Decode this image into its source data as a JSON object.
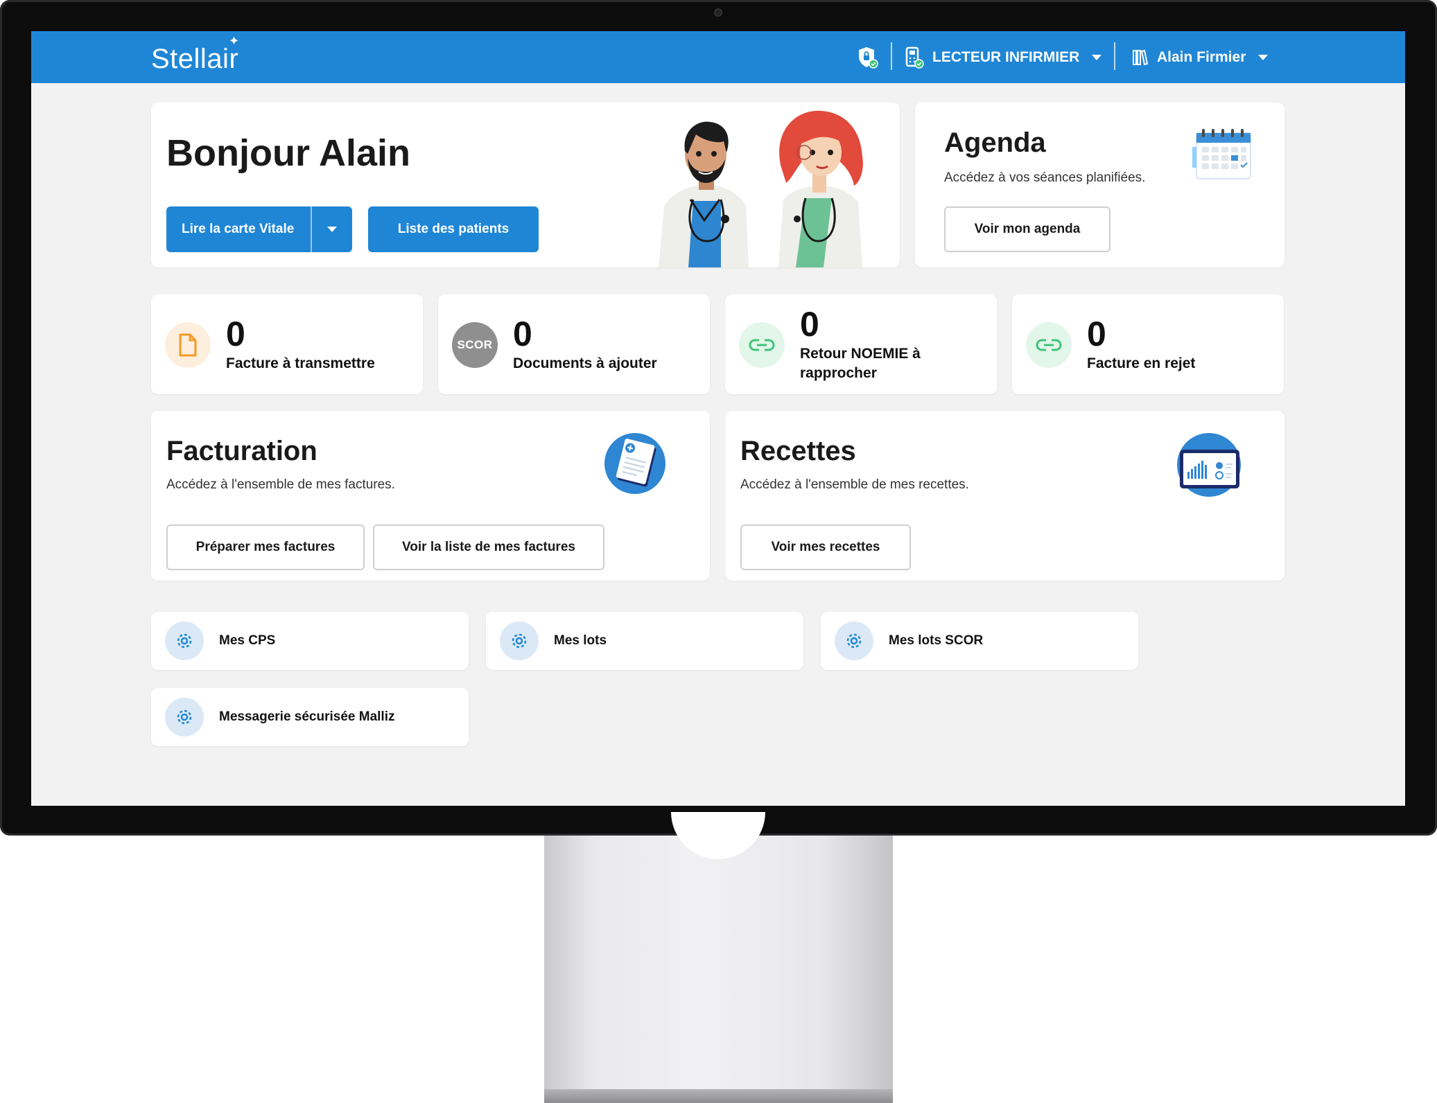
{
  "header": {
    "logo": "Stellair",
    "reader_label": "LECTEUR INFIRMIER",
    "user_name": "Alain Firmier"
  },
  "welcome": {
    "title": "Bonjour Alain",
    "vitale_button": "Lire la carte Vitale",
    "patients_button": "Liste des patients"
  },
  "agenda": {
    "title": "Agenda",
    "subtitle": "Accédez à vos séances planifiées.",
    "button": "Voir mon agenda"
  },
  "stats": [
    {
      "value": "0",
      "label": "Facture à transmettre",
      "icon": "document-icon"
    },
    {
      "value": "0",
      "label": "Documents à ajouter",
      "icon": "scor-icon",
      "badge": "SCOR"
    },
    {
      "value": "0",
      "label_line1": "Retour NOEMIE à",
      "label_line2": "rapprocher",
      "icon": "link-icon"
    },
    {
      "value": "0",
      "label": "Facture en rejet",
      "icon": "link-icon"
    }
  ],
  "facturation": {
    "title": "Facturation",
    "subtitle": "Accédez à l'ensemble de mes factures.",
    "button_prepare": "Préparer mes factures",
    "button_list": "Voir la liste de mes factures"
  },
  "recettes": {
    "title": "Recettes",
    "subtitle": "Accédez à l'ensemble de mes recettes.",
    "button": "Voir mes recettes"
  },
  "links": [
    {
      "label": "Mes CPS",
      "icon": "gear-icon"
    },
    {
      "label": "Mes lots",
      "icon": "gear-icon"
    },
    {
      "label": "Mes lots SCOR",
      "icon": "gear-icon"
    },
    {
      "label": "Messagerie sécurisée Malliz",
      "icon": "gear-icon"
    }
  ],
  "colors": {
    "primary": "#1f86d6",
    "background": "#f2f2f2",
    "orange_icon": "#f59a23",
    "green_icon": "#3ec47a",
    "gear_bg": "#dbe9f7"
  }
}
